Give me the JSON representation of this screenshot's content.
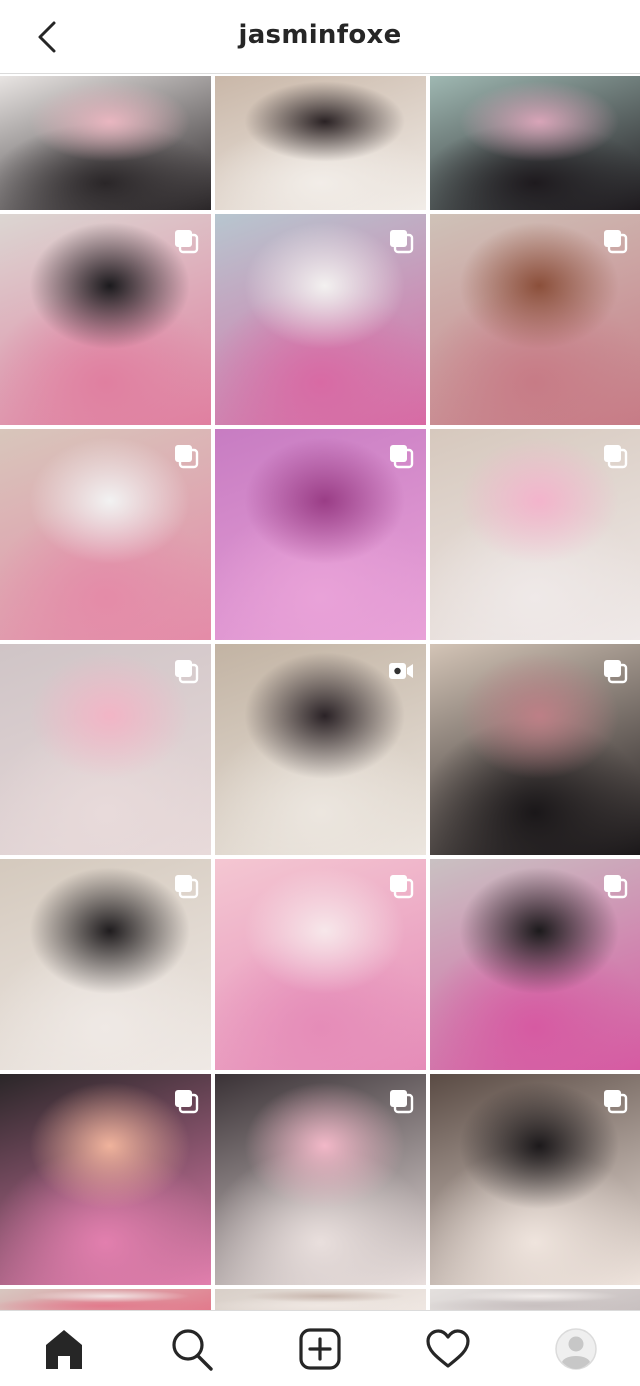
{
  "header": {
    "username": "jasminfoxe",
    "back_icon": "chevron-left-icon"
  },
  "grid": {
    "columns": 3,
    "tiles": [
      {
        "badge": "none",
        "palette": [
          "#e8e4e2",
          "#2a2628",
          "#e9b6c0"
        ]
      },
      {
        "badge": "none",
        "palette": [
          "#c9b7a8",
          "#f2ede8",
          "#2a2224"
        ]
      },
      {
        "badge": "none",
        "palette": [
          "#9fb8b2",
          "#1e1a1e",
          "#d8a4b8"
        ]
      },
      {
        "badge": "carousel",
        "palette": [
          "#dcd6d2",
          "#e07fa0",
          "#1b1a1d"
        ]
      },
      {
        "badge": "carousel",
        "palette": [
          "#b7c6cf",
          "#d86aa4",
          "#f3f1f0"
        ]
      },
      {
        "badge": "carousel",
        "palette": [
          "#cfc2b8",
          "#c77b86",
          "#8b4f3a"
        ]
      },
      {
        "badge": "carousel",
        "palette": [
          "#d8c6bb",
          "#e48ba8",
          "#f2f2f2"
        ]
      },
      {
        "badge": "carousel",
        "palette": [
          "#c77cc2",
          "#e9a2d8",
          "#9a3d86"
        ]
      },
      {
        "badge": "carousel",
        "palette": [
          "#d6c8bd",
          "#efe9e8",
          "#f3b4cc"
        ]
      },
      {
        "badge": "carousel",
        "palette": [
          "#cfc4c6",
          "#e8dada",
          "#f2b5c6"
        ]
      },
      {
        "badge": "video",
        "palette": [
          "#c2b3a3",
          "#ece6df",
          "#2a2226"
        ]
      },
      {
        "badge": "carousel",
        "palette": [
          "#d3c4b6",
          "#1a1719",
          "#bd7f86"
        ]
      },
      {
        "badge": "carousel",
        "palette": [
          "#d4c9bd",
          "#efe9e5",
          "#1f1c1e"
        ]
      },
      {
        "badge": "carousel",
        "palette": [
          "#f4c7d2",
          "#e58cb8",
          "#f7e7ea"
        ]
      },
      {
        "badge": "carousel",
        "palette": [
          "#c9c1c2",
          "#d65aa2",
          "#1c1a1c"
        ]
      },
      {
        "badge": "carousel",
        "palette": [
          "#2a2628",
          "#e27fae",
          "#f0b39c"
        ]
      },
      {
        "badge": "carousel",
        "palette": [
          "#3a3236",
          "#e9dfdd",
          "#f2b8c8"
        ]
      },
      {
        "badge": "carousel",
        "palette": [
          "#5a4b44",
          "#efe4dd",
          "#1c191b"
        ]
      },
      {
        "badge": "none",
        "palette": [
          "#d7c7c0",
          "#e27a8c",
          "#f2e2e2"
        ]
      },
      {
        "badge": "none",
        "palette": [
          "#d8cfc8",
          "#efe7e2",
          "#c9b7ae"
        ]
      },
      {
        "badge": "none",
        "palette": [
          "#e4e0de",
          "#c8c0c0",
          "#f0ebe9"
        ]
      }
    ]
  },
  "navbar": {
    "items": [
      {
        "icon": "home-icon",
        "active": true
      },
      {
        "icon": "search-icon",
        "active": false
      },
      {
        "icon": "add-post-icon",
        "active": false
      },
      {
        "icon": "heart-icon",
        "active": false
      },
      {
        "icon": "profile-avatar-icon",
        "active": false
      }
    ]
  },
  "colors": {
    "text": "#262626",
    "divider": "#dbdbdb",
    "background": "#ffffff",
    "badge": "#ffffff"
  }
}
